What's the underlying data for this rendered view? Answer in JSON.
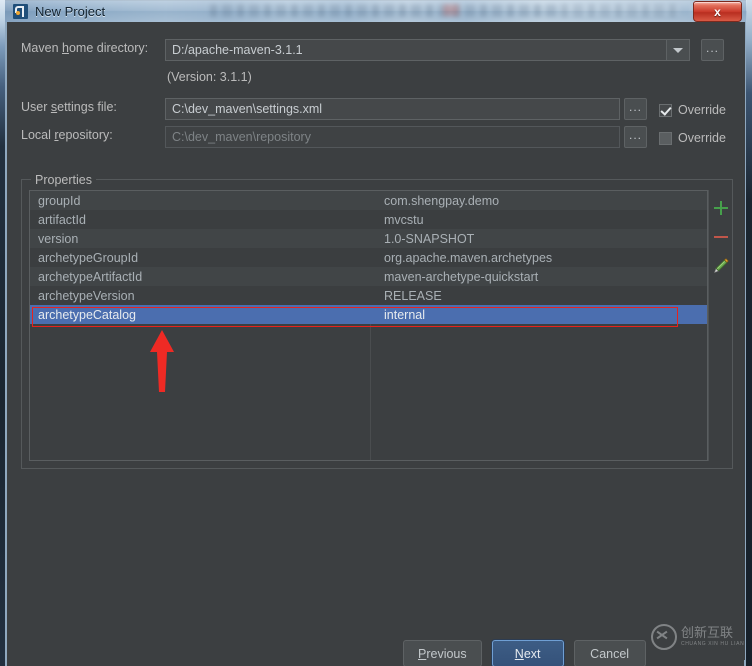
{
  "window": {
    "title": "New Project",
    "app_icon": "intellij-idea-icon",
    "close_label": "x"
  },
  "form": {
    "maven_home": {
      "label_pre": "Maven ",
      "label_mnemonic": "h",
      "label_post": "ome directory:",
      "value": "D:/apache-maven-3.1.1",
      "dropdown_icon": "chevron-down-icon",
      "browse_label": "..."
    },
    "version_note": "(Version: 3.1.1)",
    "user_settings": {
      "label_pre": "User ",
      "label_mnemonic": "s",
      "label_post": "ettings file:",
      "value": "C:\\dev_maven\\settings.xml",
      "browse_label": "...",
      "override_label": "Override",
      "override_checked": true
    },
    "local_repository": {
      "label_pre": "Local ",
      "label_mnemonic": "r",
      "label_post": "epository:",
      "value": "C:\\dev_maven\\repository",
      "browse_label": "...",
      "override_label": "Override",
      "override_checked": false
    }
  },
  "properties": {
    "group_title": "Properties",
    "columns": [
      "",
      ""
    ],
    "rows": [
      {
        "key": "groupId",
        "value": "com.shengpay.demo",
        "selected": false
      },
      {
        "key": "artifactId",
        "value": "mvcstu",
        "selected": false
      },
      {
        "key": "version",
        "value": "1.0-SNAPSHOT",
        "selected": false
      },
      {
        "key": "archetypeGroupId",
        "value": "org.apache.maven.archetypes",
        "selected": false
      },
      {
        "key": "archetypeArtifactId",
        "value": "maven-archetype-quickstart",
        "selected": false
      },
      {
        "key": "archetypeVersion",
        "value": "RELEASE",
        "selected": false
      },
      {
        "key": "archetypeCatalog",
        "value": "internal",
        "selected": true
      }
    ],
    "toolbar": [
      {
        "icon": "add-plus-icon",
        "color": "#46a04b"
      },
      {
        "icon": "remove-minus-icon",
        "color": "#c0564a"
      },
      {
        "icon": "edit-pencil-icon",
        "color": "#6aa84f"
      }
    ]
  },
  "annotation": {
    "arrow_icon": "red-up-arrow-icon",
    "highlight_color": "#e8221d"
  },
  "buttons": {
    "previous": {
      "pre": "",
      "mnemonic": "P",
      "post": "revious"
    },
    "next": {
      "pre": "",
      "mnemonic": "N",
      "post": "ext"
    },
    "cancel": {
      "pre": "Cancel",
      "mnemonic": "",
      "post": ""
    }
  },
  "watermark": {
    "cn": "创新互联",
    "pinyin": "CHUANG XIN HU LIAN"
  },
  "colors": {
    "selection": "#4b6eaf",
    "annotation_red": "#e8221d",
    "dialog_bg": "#3c3f41",
    "default_button": "#3d5d85"
  }
}
